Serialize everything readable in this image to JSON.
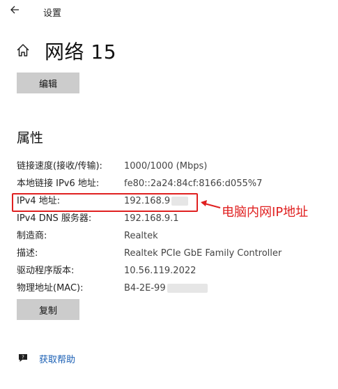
{
  "titlebar": {
    "back_icon": "back-arrow-icon",
    "title": "设置"
  },
  "header": {
    "home_icon": "home-icon",
    "title": "网络 15",
    "edit_button": "编辑"
  },
  "properties": {
    "section_title": "属性",
    "rows": [
      {
        "label": "链接速度(接收/传输):",
        "value": "1000/1000 (Mbps)"
      },
      {
        "label": "本地链接 IPv6 地址:",
        "value": "fe80::2a24:84cf:8166:d055%7"
      },
      {
        "label": "IPv4 地址:",
        "value": "192.168.9"
      },
      {
        "label": "IPv4 DNS 服务器:",
        "value": "192.168.9.1"
      },
      {
        "label": "制造商:",
        "value": "Realtek"
      },
      {
        "label": "描述:",
        "value": "Realtek PCIe GbE Family Controller"
      },
      {
        "label": "驱动程序版本:",
        "value": "10.56.119.2022"
      },
      {
        "label": "物理地址(MAC):",
        "value": "B4-2E-99"
      }
    ],
    "copy_button": "复制"
  },
  "annotation": {
    "text": "电脑内网IP地址",
    "color": "#e02020"
  },
  "help": {
    "icon": "help-chat-icon",
    "label": "获取帮助",
    "link_color": "#1a5fb4"
  }
}
